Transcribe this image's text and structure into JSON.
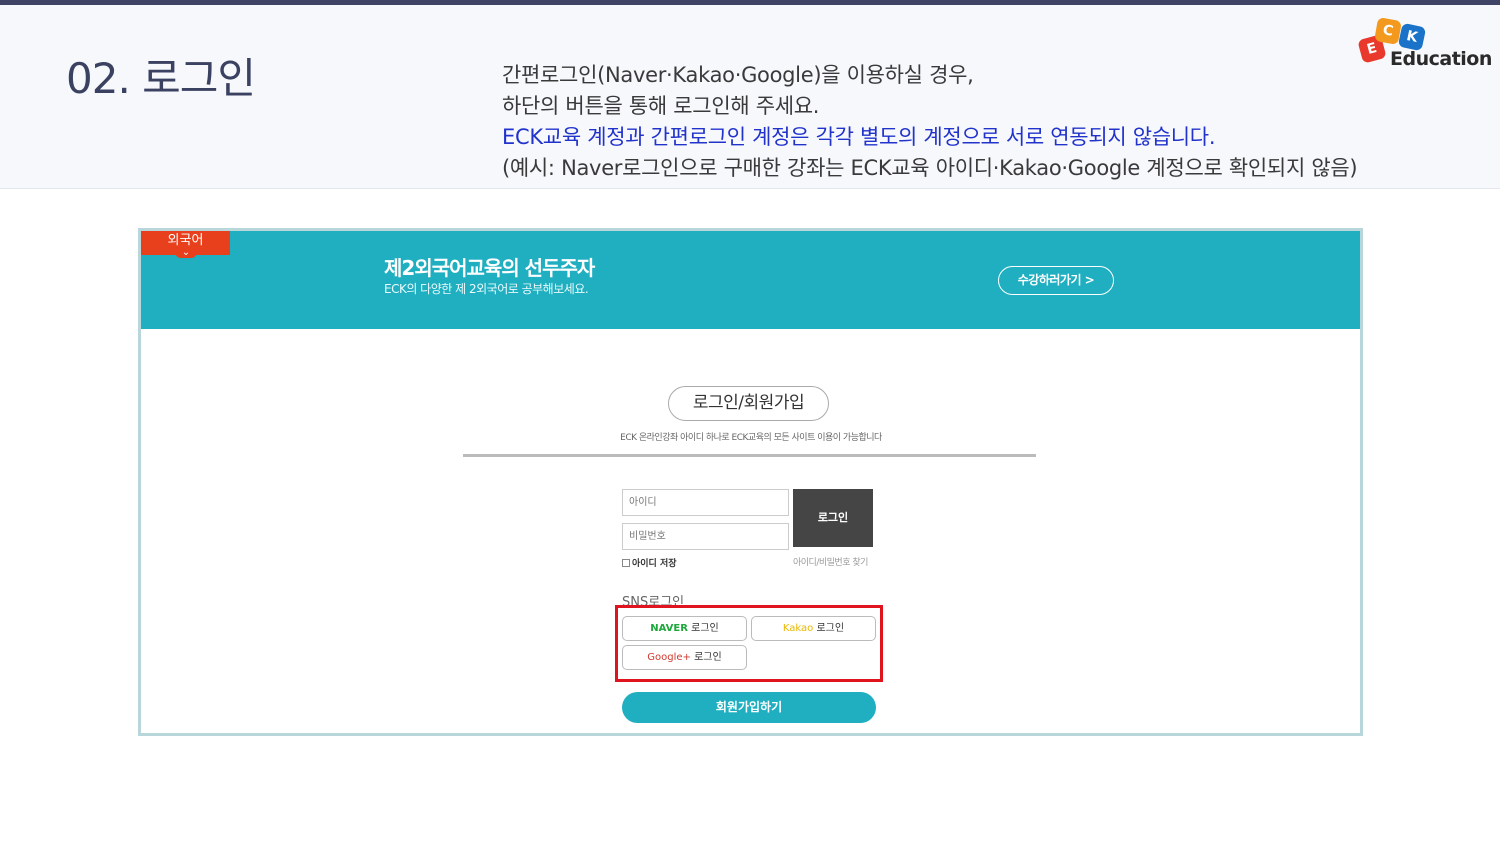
{
  "slide": {
    "title": "02. 로그인",
    "desc_line1": "간편로그인(Naver·Kakao·Google)을 이용하실 경우,",
    "desc_line2": "하단의 버튼을 통해 로그인해 주세요.",
    "desc_line3_highlight": "ECK교육 계정과 간편로그인 계정은 각각 별도의 계정으로 서로 연동되지 않습니다.",
    "desc_line4": "(예시: Naver로그인으로 구매한 강좌는 ECK교육 아이디·Kakao·Google 계정으로 확인되지 않음)",
    "highlight_color": "#2233cc"
  },
  "logo": {
    "letter_e": "E",
    "letter_c": "C",
    "letter_k": "K",
    "wordmark": "Education",
    "colors": {
      "e": "#e8392c",
      "c": "#f39a1e",
      "k": "#1a73c8"
    }
  },
  "site": {
    "category_tag": "외국어",
    "tag_arrow": "⌄",
    "banner_title": "제2외국어교육의 선두주자",
    "banner_subtitle": "ECK의 다양한 제 2외국어로 공부해보세요.",
    "banner_button": "수강하러가기 >",
    "banner_color": "#1fafc0",
    "login_pill": "로그인/회원가입",
    "login_desc": "ECK 온라인강좌 아이디 하나로 ECK교육의 모든 사이트 이용이 가능합니다",
    "id_placeholder": "아이디",
    "pw_placeholder": "비밀번호",
    "login_button": "로그인",
    "save_id_label": "아이디 저장",
    "find_link": "아이디/비밀번호 찾기",
    "sns_label": "SNS로그인",
    "naver_brand": "NAVER",
    "kakao_brand": "Kakao",
    "google_brand": "Google+",
    "sns_suffix": "로그인",
    "signup_button": "회원가입하기"
  }
}
